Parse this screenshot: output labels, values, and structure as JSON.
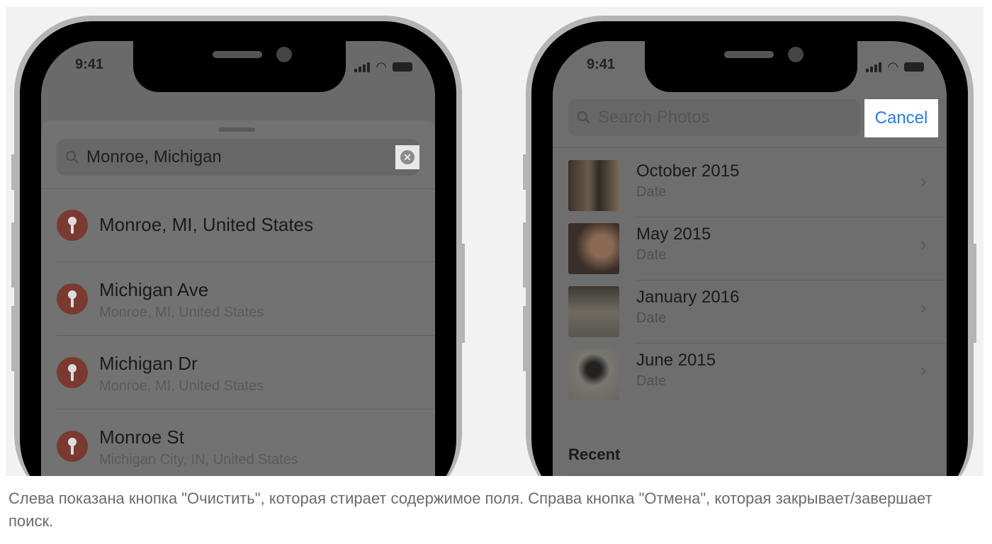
{
  "left_phone": {
    "status_time": "9:41",
    "search": {
      "value": "Monroe, Michigan",
      "clear_icon": "clear-circle-x-icon"
    },
    "results": [
      {
        "title": "Monroe, MI, United States",
        "subtitle": ""
      },
      {
        "title": "Michigan Ave",
        "subtitle": "Monroe, MI, United States"
      },
      {
        "title": "Michigan Dr",
        "subtitle": "Monroe, MI, United States"
      },
      {
        "title": "Monroe St",
        "subtitle": "Michigan City, IN, United States"
      }
    ]
  },
  "right_phone": {
    "status_time": "9:41",
    "search": {
      "placeholder": "Search Photos",
      "cancel_label": "Cancel"
    },
    "results": [
      {
        "title": "October 2015",
        "subtitle": "Date"
      },
      {
        "title": "May 2015",
        "subtitle": "Date"
      },
      {
        "title": "January 2016",
        "subtitle": "Date"
      },
      {
        "title": "June 2015",
        "subtitle": "Date"
      }
    ],
    "section_header": "Recent"
  },
  "colors": {
    "accent": "#2a7ae2",
    "pin": "#7a3a30"
  },
  "caption": "Слева показана кнопка \"Очистить\", которая стирает содержимое поля. Справа кнопка \"Отмена\", которая закрывает/завершает поиск."
}
